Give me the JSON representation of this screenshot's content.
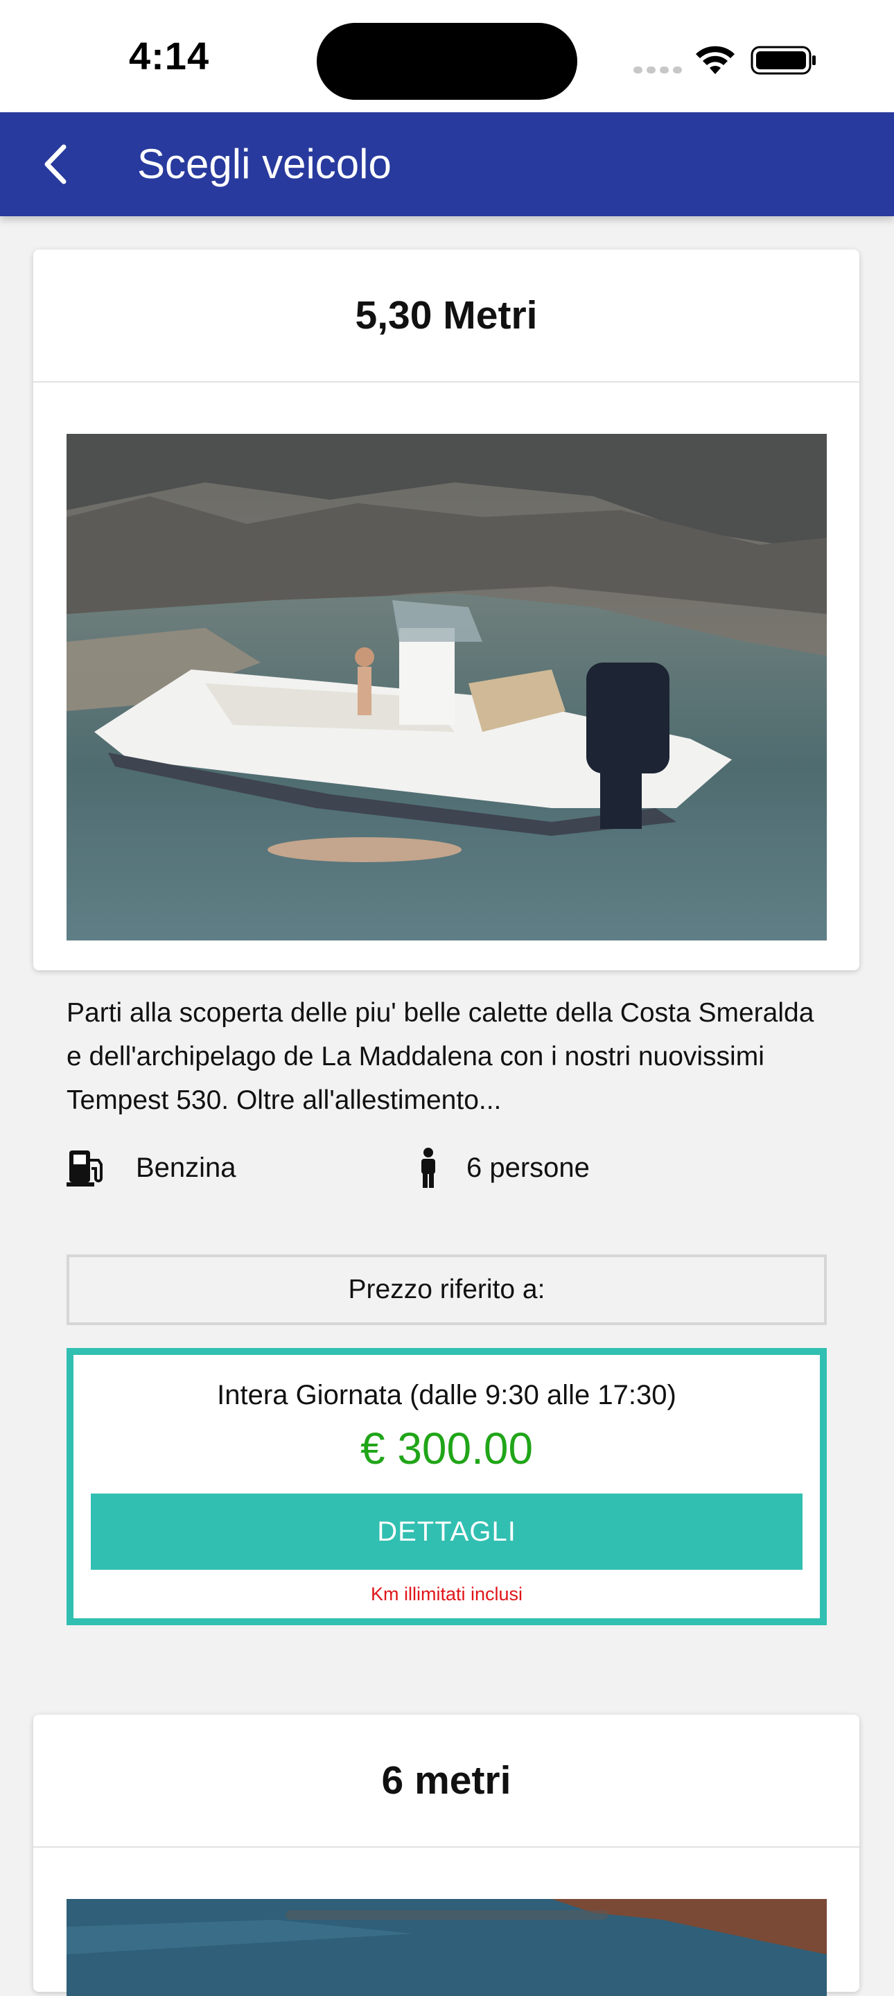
{
  "status_bar": {
    "time": "4:14"
  },
  "app_bar": {
    "title": "Scegli veicolo",
    "back_icon": "chevron-left-icon"
  },
  "vehicles": [
    {
      "title": "5,30 Metri",
      "description": "Parti alla scoperta delle piu' belle calette della Costa Smeralda e dell'archipelago de La Maddalena con i nostri nuovissimi Tempest 530. Oltre all'allestimento...",
      "fuel": "Benzina",
      "fuel_icon": "fuel-pump-icon",
      "capacity": "6 persone",
      "capacity_icon": "person-icon",
      "price_reference_label": "Prezzo riferito a:",
      "price_period": "Intera Giornata (dalle 9:30 alle 17:30)",
      "price": "€ 300.00",
      "details_button": "DETTAGLI",
      "note": "Km illimitati inclusi"
    },
    {
      "title": "6 metri"
    }
  ],
  "colors": {
    "app_bar": "#283a9d",
    "accent": "#31bfb1",
    "price": "#20a518",
    "note": "#e0151a"
  }
}
